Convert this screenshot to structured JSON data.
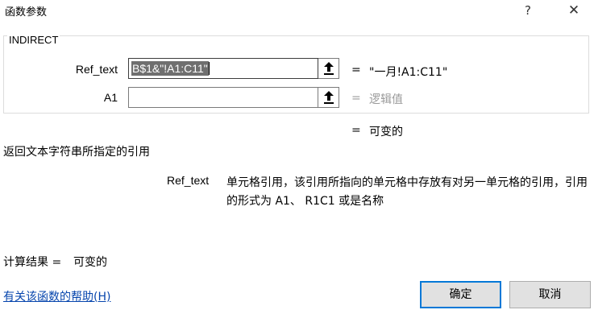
{
  "window": {
    "title": "函数参数",
    "help_glyph": "?",
    "close_glyph": "✕"
  },
  "function": {
    "name": "INDIRECT",
    "args": [
      {
        "label": "Ref_text",
        "value_selected": "B$1&\"!A1:C11\"",
        "equals": "=",
        "result": "\"一月!A1:C11\""
      },
      {
        "label": "A1",
        "value_selected": "",
        "equals": "=",
        "result": "逻辑值"
      }
    ],
    "formula_equals": "=",
    "formula_value": "可变的",
    "description": "返回文本字符串所指定的引用",
    "arg_description": {
      "name": "Ref_text",
      "text": "单元格引用，该引用所指向的单元格中存放有对另一单元格的引用，引用的形式为 A1、 R1C1 或是名称"
    }
  },
  "calc": {
    "label": "计算结果 =",
    "value": "可变的"
  },
  "footer": {
    "help_link": "有关该函数的帮助(H)",
    "ok_label": "确定",
    "cancel_label": "取消"
  },
  "colors": {
    "primary_border": "#0078d7",
    "link": "#0645ad",
    "placeholder": "#9a9a9a"
  },
  "icons": {
    "ref_button": "collapse-dialog-arrow-icon"
  }
}
